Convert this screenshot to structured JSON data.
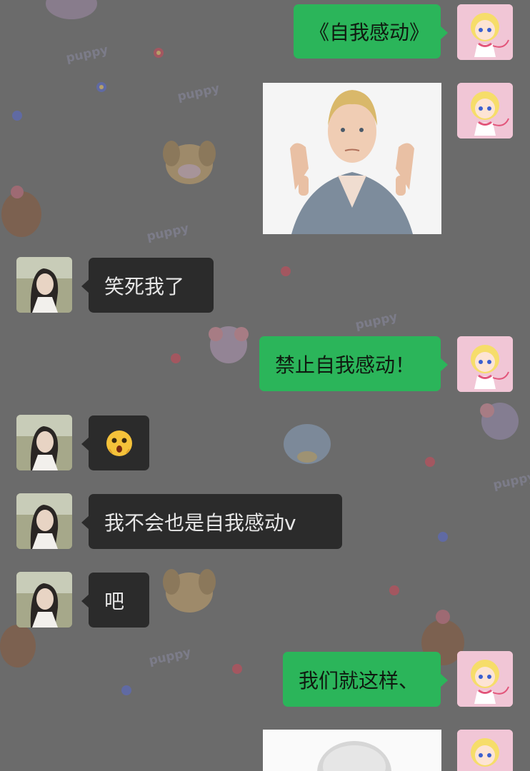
{
  "wallpaper": {
    "word": "puppy"
  },
  "messages": [
    {
      "side": "self",
      "type": "text",
      "text": "《自我感动》"
    },
    {
      "side": "self",
      "type": "image",
      "description": "thumbs-down-woman-photo"
    },
    {
      "side": "peer",
      "type": "text",
      "text": "笑死我了"
    },
    {
      "side": "self",
      "type": "text",
      "text": "禁止自我感动！"
    },
    {
      "side": "peer",
      "type": "emoji",
      "emoji_name": "shocked-face-icon"
    },
    {
      "side": "peer",
      "type": "text",
      "text": "我不会也是自我感动v"
    },
    {
      "side": "peer",
      "type": "text",
      "text": "吧"
    },
    {
      "side": "self",
      "type": "text",
      "text": "我们就这样、"
    },
    {
      "side": "self",
      "type": "image",
      "description": "bald-head-photo"
    }
  ],
  "colors": {
    "self_bubble": "#2bb55a",
    "peer_bubble": "#2b2b2b",
    "background": "#6b6b6b"
  }
}
